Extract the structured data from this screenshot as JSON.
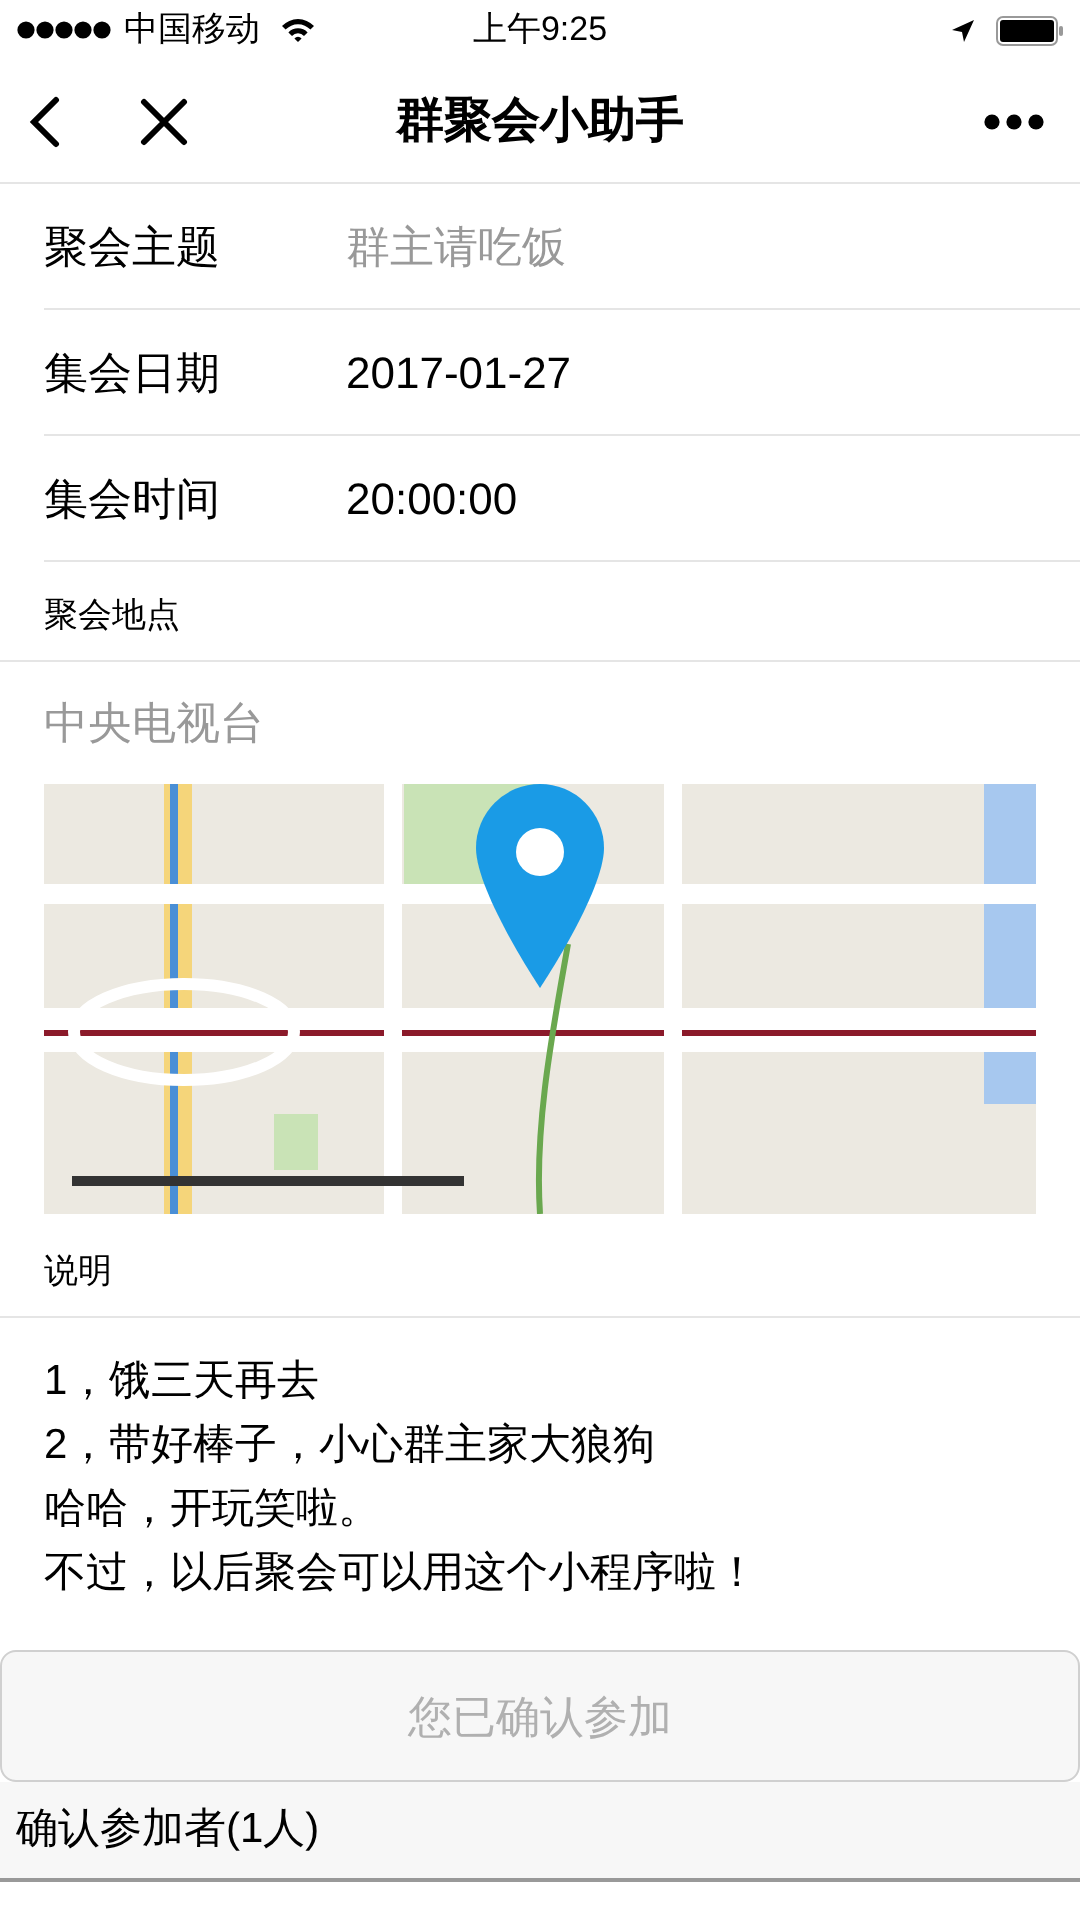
{
  "status_bar": {
    "carrier": "中国移动",
    "time": "上午9:25"
  },
  "nav": {
    "title": "群聚会小助手"
  },
  "fields": [
    {
      "label": "聚会主题",
      "placeholder": "群主请吃饭"
    },
    {
      "label": "集会日期",
      "value": "2017-01-27"
    },
    {
      "label": "集会时间",
      "value": "20:00:00"
    }
  ],
  "location": {
    "label": "聚会地点",
    "placeholder": "中央电视台"
  },
  "notes": {
    "label": "说明",
    "lines": [
      "1，饿三天再去",
      "2，带好棒子，小心群主家大狼狗",
      "哈哈，开玩笑啦。",
      "不过，以后聚会可以用这个小程序啦！"
    ]
  },
  "confirm_button": {
    "label": "您已确认参加",
    "disabled": true
  },
  "attendees": {
    "label": "确认参加者(1人)"
  }
}
